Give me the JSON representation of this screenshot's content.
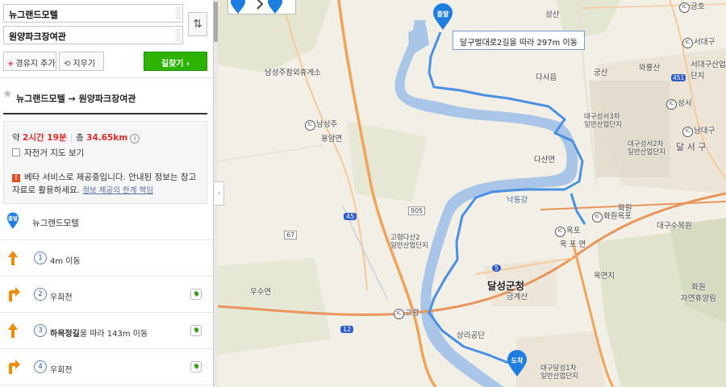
{
  "search": {
    "from_value": "뉴그랜드모텔",
    "to_value": "원양파크장여관",
    "swap_icon": "⇅",
    "add_waypoint_label": "경유지 추가",
    "clear_label": "지우기",
    "search_label": "길찾기 ›"
  },
  "route": {
    "title": "뉴그랜드모텔 → 원양파크장여관",
    "summary_prefix": "약",
    "time": "2시간 19분",
    "total_prefix": "총",
    "distance": "34.65km",
    "bike_map_label": "자전거 지도 보기",
    "beta_notice": "베타 서비스로 제공중입니다. 안내된 정보는 참고자료로 활용하세요.",
    "beta_link": "정보 제공의 한계 책임"
  },
  "steps": [
    {
      "kind": "start",
      "badge": "출발",
      "label": "뉴그랜드모텔"
    },
    {
      "kind": "straight",
      "num": "1",
      "label": "4m 이동"
    },
    {
      "kind": "right",
      "num": "2",
      "label": "우회전"
    },
    {
      "kind": "straight",
      "num": "3",
      "label_bold": "하목정길",
      "label": "을 따라 143m 이동"
    },
    {
      "kind": "right",
      "num": "4",
      "label": "우회전"
    }
  ],
  "map": {
    "callout": "달구벌대로2길을 따라 297m 이동",
    "start_badge": "출발",
    "end_badge": "도착",
    "route_color": "#4a90e2",
    "river_color": "#a9c6e8",
    "labels": {
      "seongsan": "성산",
      "gumseo": "금호",
      "seodaegu": "서대구",
      "waryongsan": "와룡산",
      "seodaegu_ind": "서대구산업\n단지",
      "gungsan": "궁산",
      "dasa": "다사읍",
      "seongseo": "성서",
      "daegu_seongseo3": "대구성서3차\n일반산업단지",
      "nam_daegu": "남대구",
      "daegu_seongseo2": "대구성서2차\n일반산업단지",
      "dalseo": "달 서 구",
      "namseongju_rest": "남성주참외휴게소",
      "namseongju": "남성주",
      "yongam": "용암면",
      "dasan": "다산면",
      "nakdong": "낙동강",
      "hwawon": "화원",
      "hwawonokpo": "화원옥포",
      "daegu_arboretum": "대구수목원",
      "goryeong_dasan2": "고령다산2\n일반산업단지",
      "okpo_ic": "옥포",
      "okpo": "옥 포 면",
      "dalseong": "달성군청",
      "geumgyesan": "금계산",
      "okyeonji": "옥연지",
      "goryeong": "고령",
      "usu": "우수면",
      "sangri": "상리공단",
      "hwawon_park": "화원\n자연휴양림",
      "daegu_dalseong1": "대구달성1차\n일반산업단지",
      "road_905": "905",
      "road_67": "67",
      "road_45": "45",
      "road_12": "12",
      "road_5": "5",
      "road_451": "451"
    }
  }
}
